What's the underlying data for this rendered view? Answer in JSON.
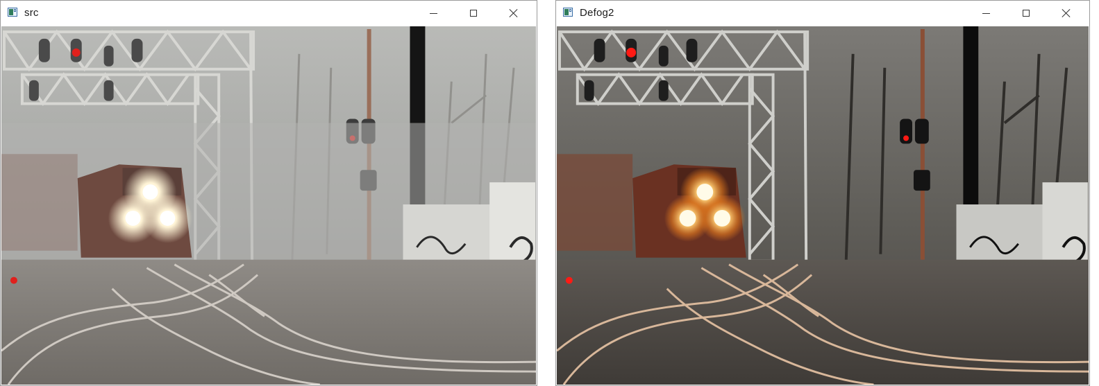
{
  "windows": [
    {
      "title": "src",
      "icon": "opencv-window-icon",
      "controls": [
        "minimize-icon",
        "maximize-icon",
        "close-icon"
      ],
      "image": {
        "content": "railway-train-in-fog-original"
      }
    },
    {
      "title": "Defog2",
      "icon": "opencv-window-icon",
      "controls": [
        "minimize-icon",
        "maximize-icon",
        "close-icon"
      ],
      "image": {
        "content": "railway-train-defogged-result"
      }
    }
  ],
  "colors": {
    "fog_src": "#a9aaa7",
    "fog_defog": "#6d6a64",
    "signal_red": "#e0201c",
    "headlight": "#fff3c8"
  }
}
